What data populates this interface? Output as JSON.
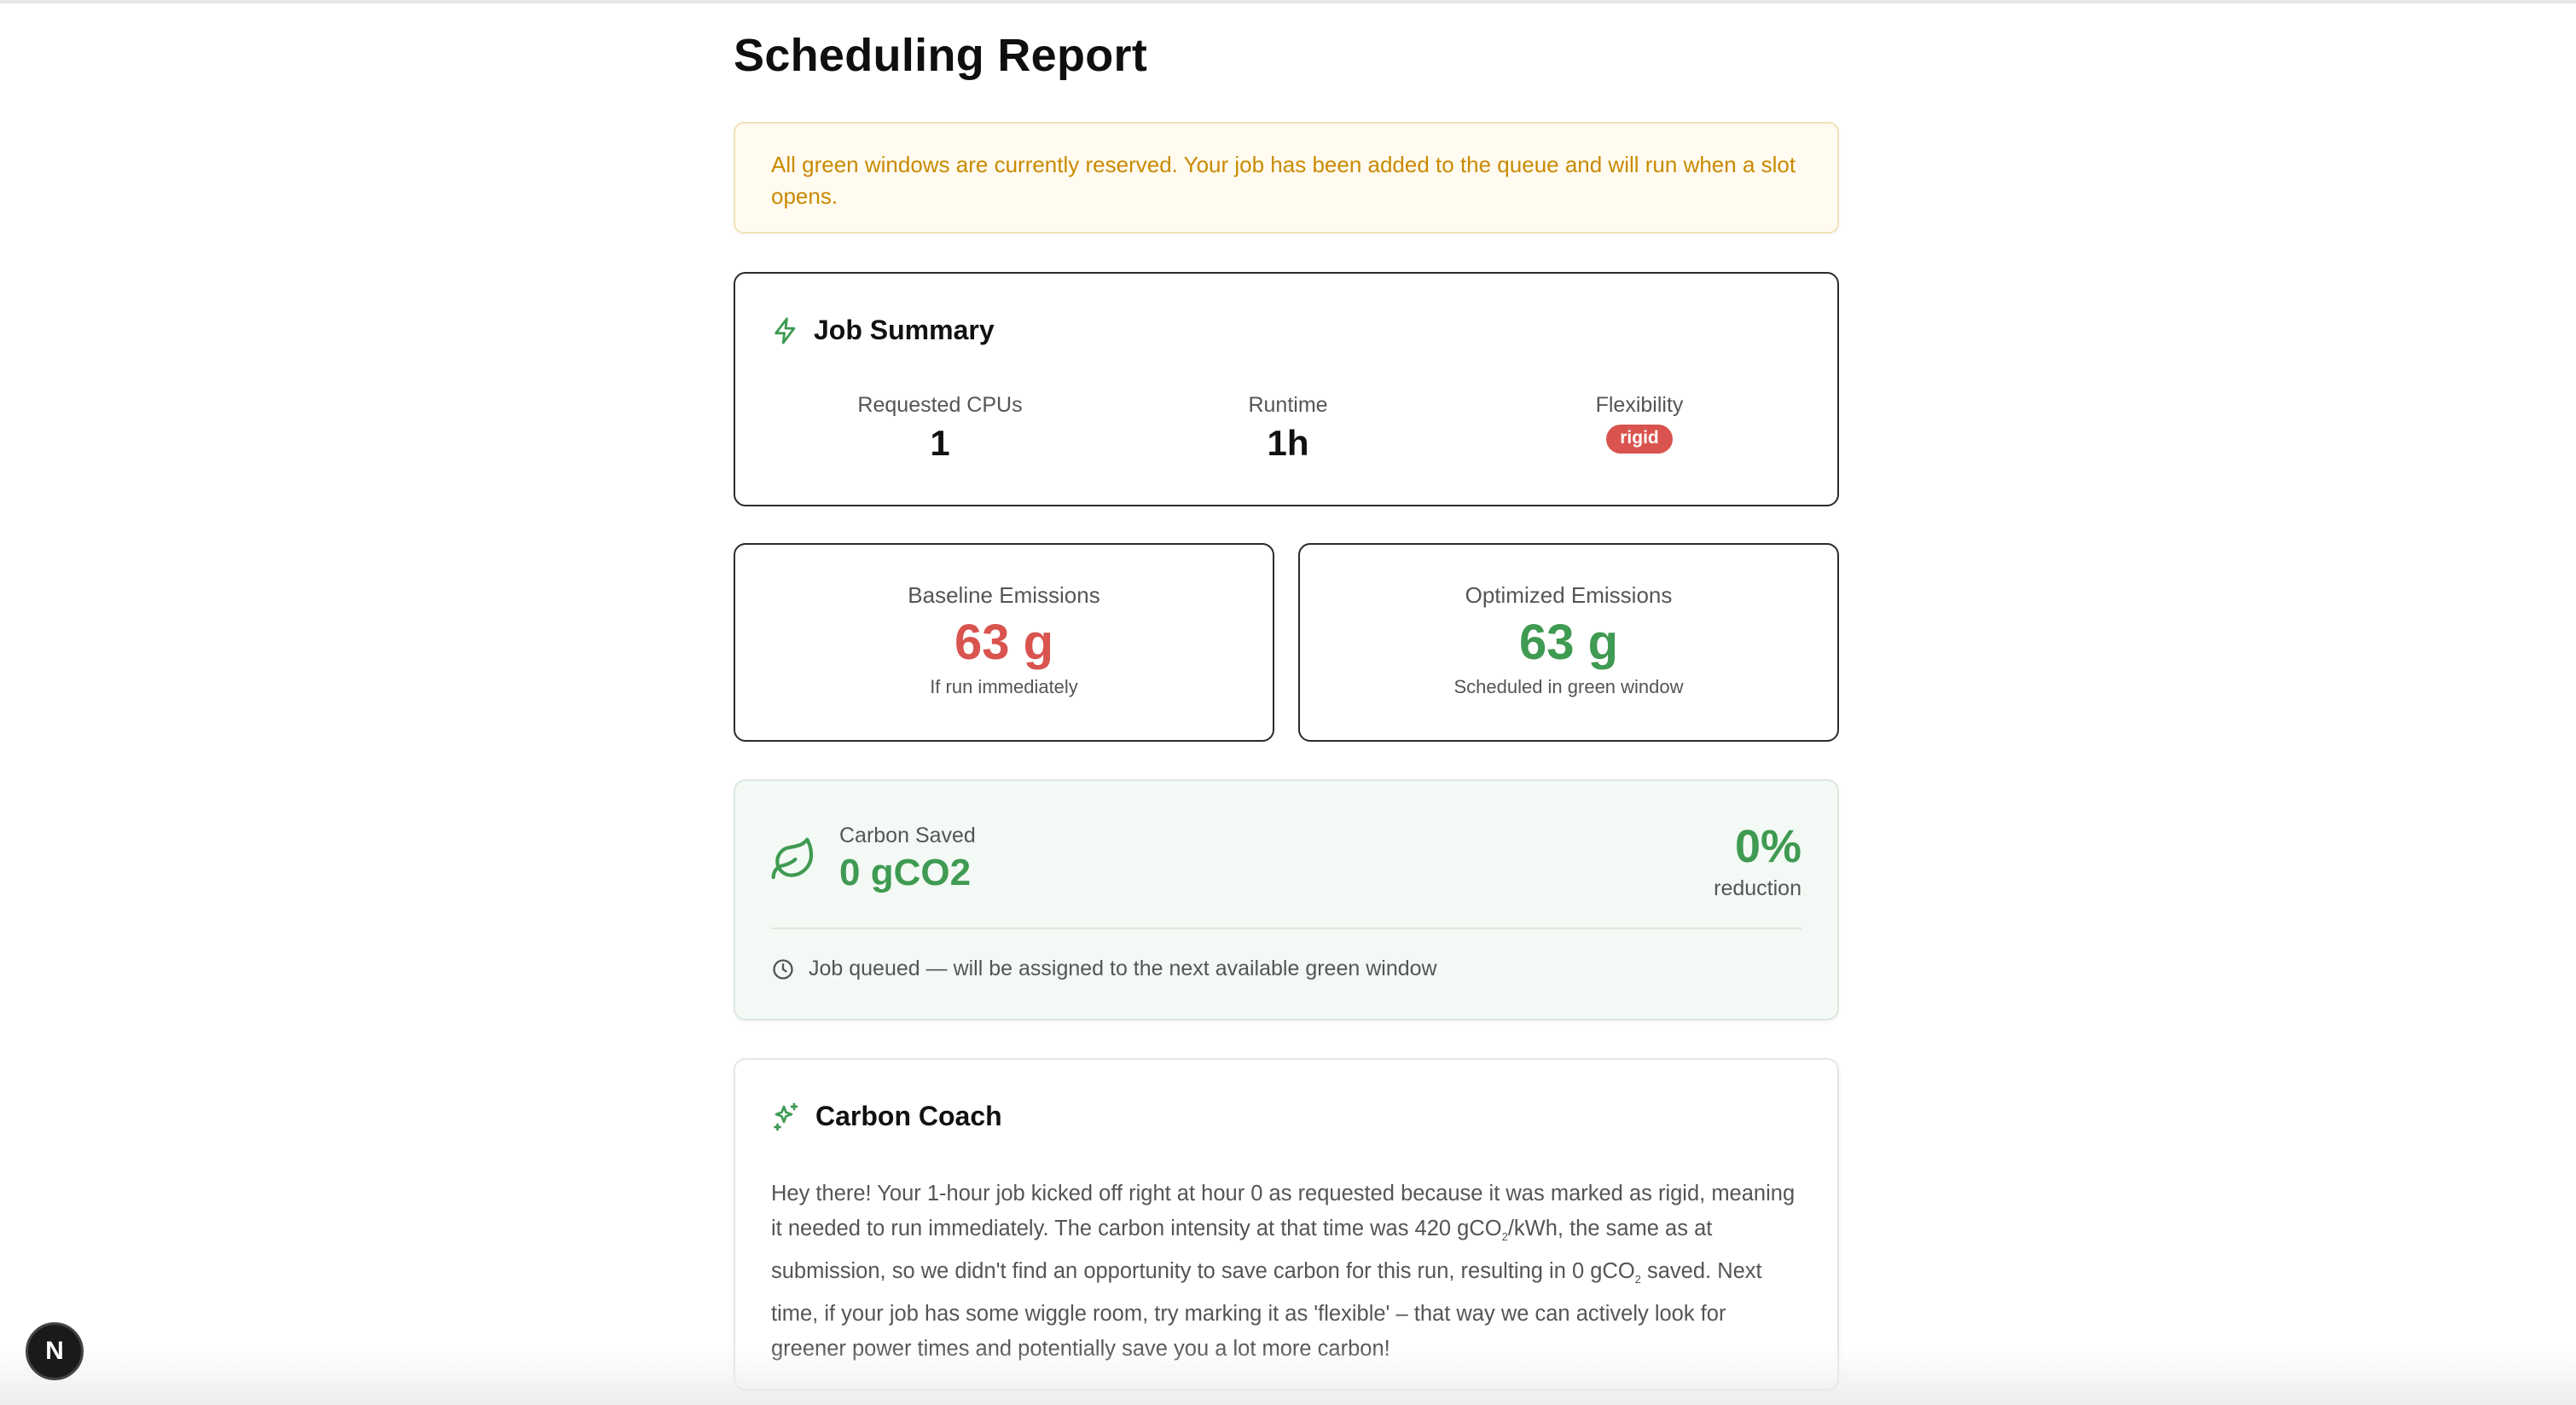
{
  "page": {
    "title": "Scheduling Report"
  },
  "alert": {
    "message": "All green windows are currently reserved. Your job has been added to the queue and will run when a slot opens."
  },
  "job_summary": {
    "title": "Job Summary",
    "icon": "lightning-icon",
    "requested_cpus_label": "Requested CPUs",
    "requested_cpus_value": "1",
    "runtime_label": "Runtime",
    "runtime_value": "1h",
    "flexibility_label": "Flexibility",
    "flexibility_value": "rigid"
  },
  "baseline": {
    "label": "Baseline Emissions",
    "value": "63 g",
    "sub": "If run immediately"
  },
  "optimized": {
    "label": "Optimized Emissions",
    "value": "63 g",
    "sub": "Scheduled in green window"
  },
  "carbon_saved": {
    "icon": "leaf-icon",
    "label": "Carbon Saved",
    "value": "0 gCO2",
    "percent": "0%",
    "percent_label": "reduction",
    "status_icon": "clock-icon",
    "status": "Job queued — will be assigned to the next available green window"
  },
  "coach": {
    "icon": "sparkles-icon",
    "title": "Carbon Coach",
    "part1": "Hey there! Your 1-hour job kicked off right at hour 0 as requested because it was marked as rigid, meaning it needed to run immediately. The carbon intensity at that time was 420 gCO",
    "sub1": "2",
    "part2": "/kWh, the same as at submission, so we didn't find an opportunity to save carbon for this run, resulting in 0 gCO",
    "sub2": "2",
    "part3": " saved. Next time, if your job has some wiggle room, try marking it as 'flexible' – that way we can actively look for greener power times and potentially save you a lot more carbon!"
  },
  "devtools": {
    "label": "N"
  },
  "colors": {
    "accent_green": "#3f9a52",
    "alert_text": "#c98a00",
    "red": "#d9534f"
  }
}
